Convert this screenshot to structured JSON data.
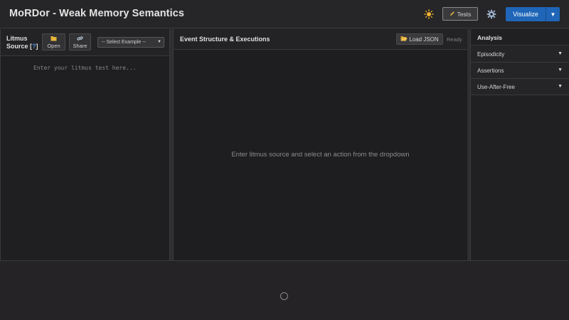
{
  "header": {
    "title": "MoRDor - Weak Memory Semantics",
    "tests_label": "Tests",
    "visualize_label": "Visualize",
    "theme_icon": "sun-icon",
    "settings_icon": "gear-icon"
  },
  "litmus": {
    "label_line1": "Litmus",
    "label_line2": "Source",
    "help_text": "?",
    "open_label": "Open",
    "share_label": "Share",
    "example_select": "-- Select Example --",
    "editor_placeholder": "Enter your litmus test here..."
  },
  "executions": {
    "title": "Event Structure & Executions",
    "load_label": "Load JSON",
    "status": "Ready",
    "empty_message": "Enter litmus source and select an action from the dropdown"
  },
  "analysis": {
    "title": "Analysis",
    "items": [
      {
        "label": "Episodicity"
      },
      {
        "label": "Assertions"
      },
      {
        "label": "Use-After-Free"
      }
    ]
  },
  "colors": {
    "accent": "#1f66b8",
    "background": "#252326",
    "panel": "#1e1d1f"
  }
}
